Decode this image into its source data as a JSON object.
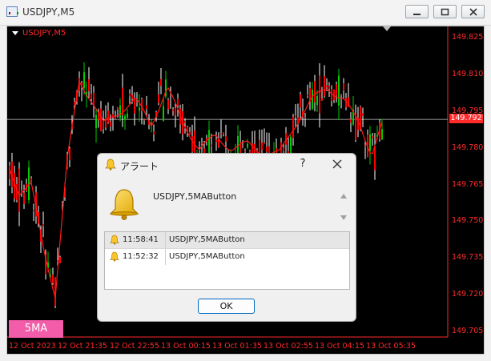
{
  "window": {
    "title": "USDJPY,M5"
  },
  "chart": {
    "label": "USDJPY,M5",
    "current_price": "149.792",
    "ma_button_label": "5MA",
    "bull_color": "#00cc00",
    "bear_color": "#ff0000",
    "ma_color": "#ff1a1a"
  },
  "chart_data": {
    "type": "candlestick",
    "symbol": "USDJPY",
    "timeframe": "M5",
    "y_ticks": [
      "149.825",
      "149.810",
      "149.795",
      "149.780",
      "149.765",
      "149.750",
      "149.735",
      "149.720",
      "149.705"
    ],
    "ylim": [
      149.703,
      149.83
    ],
    "x_ticks": [
      "12 Oct 2023",
      "12 Oct 21:35",
      "12 Oct 22:55",
      "13 Oct 00:15",
      "13 Oct 01:35",
      "13 Oct 02:55",
      "13 Oct 04:15",
      "13 Oct 05:35"
    ],
    "current_price": 149.792,
    "series": [
      {
        "name": "5MA",
        "type": "line"
      }
    ]
  },
  "dialog": {
    "title": "アラート",
    "help": "?",
    "message": "USDJPY,5MAButton",
    "alerts": [
      {
        "time": "11:58:41",
        "message": "USDJPY,5MAButton"
      },
      {
        "time": "11:52:32",
        "message": "USDJPY,5MAButton"
      }
    ],
    "ok_label": "OK"
  }
}
